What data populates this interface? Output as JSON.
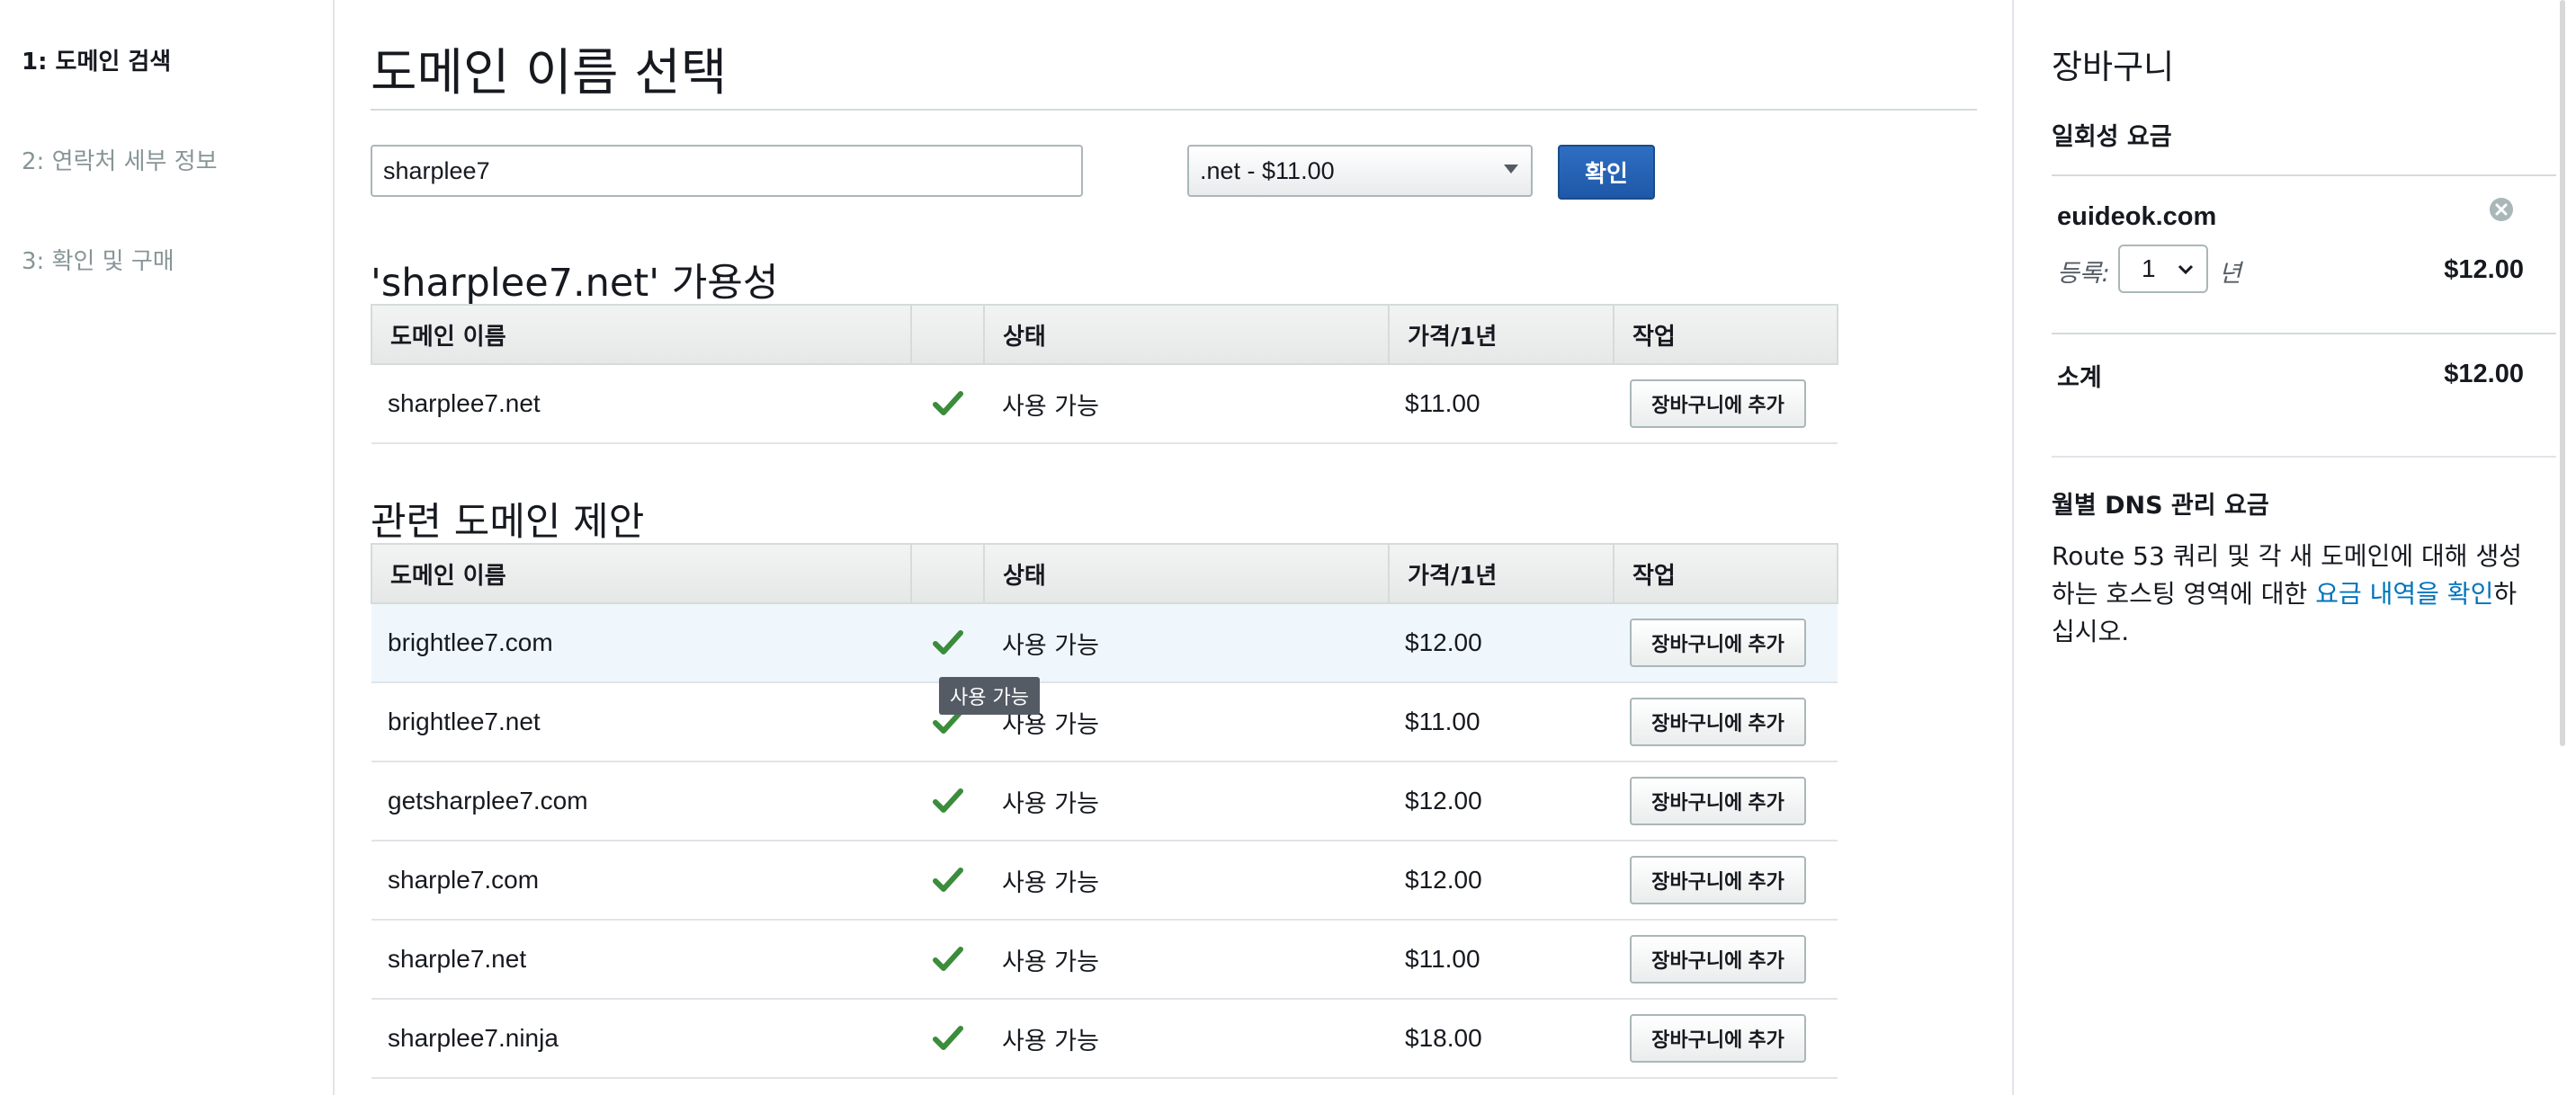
{
  "steps": [
    {
      "label": "1: 도메인 검색"
    },
    {
      "label": "2: 연락처 세부 정보"
    },
    {
      "label": "3: 확인 및 구매"
    }
  ],
  "page_title": "도메인 이름 선택",
  "search": {
    "value": "sharplee7",
    "tld_selected": ".net - $11.00",
    "confirm_label": "확인"
  },
  "availability": {
    "title": "'sharplee7.net' 가용성",
    "headers": [
      "도메인 이름",
      "",
      "상태",
      "가격/1년",
      "작업"
    ],
    "rows": [
      {
        "domain": "sharplee7.net",
        "status": "사용 가능",
        "price": "$11.00",
        "action": "장바구니에 추가"
      }
    ]
  },
  "related": {
    "title": "관련 도메인 제안",
    "headers": [
      "도메인 이름",
      "",
      "상태",
      "가격/1년",
      "작업"
    ],
    "rows": [
      {
        "domain": "brightlee7.com",
        "status": "사용 가능",
        "price": "$12.00",
        "action": "장바구니에 추가"
      },
      {
        "domain": "brightlee7.net",
        "status": "사용 가능",
        "price": "$11.00",
        "action": "장바구니에 추가"
      },
      {
        "domain": "getsharplee7.com",
        "status": "사용 가능",
        "price": "$12.00",
        "action": "장바구니에 추가"
      },
      {
        "domain": "sharple7.com",
        "status": "사용 가능",
        "price": "$12.00",
        "action": "장바구니에 추가"
      },
      {
        "domain": "sharple7.net",
        "status": "사용 가능",
        "price": "$11.00",
        "action": "장바구니에 추가"
      },
      {
        "domain": "sharplee7.ninja",
        "status": "사용 가능",
        "price": "$18.00",
        "action": "장바구니에 추가"
      }
    ],
    "tooltip": "사용 가능"
  },
  "cart": {
    "title": "장바구니",
    "one_time_label": "일회성 요금",
    "item": {
      "domain": "euideok.com",
      "reg_label": "등록:",
      "years": "1",
      "year_unit": "년",
      "price": "$12.00"
    },
    "subtotal_label": "소계",
    "subtotal": "$12.00",
    "monthly_label": "월별 DNS 관리 요금",
    "dns_text_before": "Route 53 쿼리 및 각 새 도메인에 대해 생성하는 호스팅 영역에 대한 ",
    "dns_link": "요금 내역을 확인",
    "dns_text_after": "하십시오."
  },
  "icons": {
    "check": "check-icon",
    "remove": "remove-circle-icon",
    "dropdown": "chevron-down-icon"
  },
  "colors": {
    "accent": "#1f58a8",
    "check": "#3b8c3b",
    "link": "#0073bb",
    "highlight_row": "#f0f7fc"
  }
}
